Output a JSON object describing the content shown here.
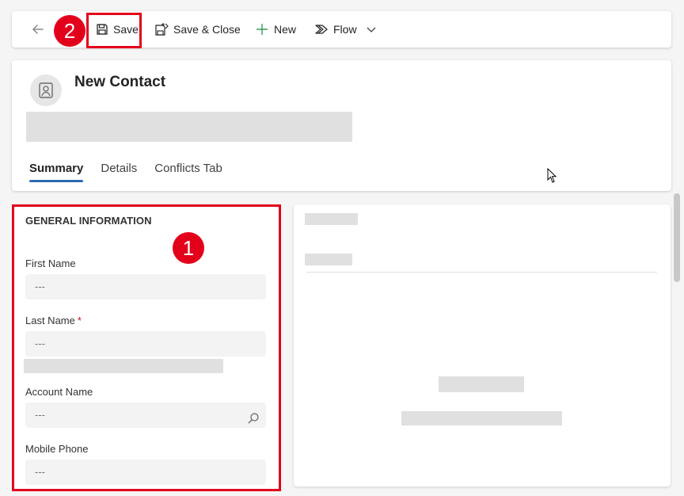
{
  "toolbar": {
    "back_label": "Back",
    "save_label": "Save",
    "save_close_label": "Save & Close",
    "new_label": "New",
    "flow_label": "Flow"
  },
  "annotations": {
    "badge_1": "1",
    "badge_2": "2"
  },
  "header": {
    "title": "New Contact",
    "tabs": [
      {
        "label": "Summary",
        "active": true
      },
      {
        "label": "Details",
        "active": false
      },
      {
        "label": "Conflicts Tab",
        "active": false
      }
    ]
  },
  "general_information": {
    "section_title": "GENERAL INFORMATION",
    "fields": [
      {
        "label": "First Name",
        "value": "---",
        "required": false
      },
      {
        "label": "Last Name",
        "value": "---",
        "required": true,
        "required_marker": "*"
      },
      {
        "label": "Account Name",
        "value": "---",
        "required": false,
        "icon": "search-icon"
      },
      {
        "label": "Mobile Phone",
        "value": "---",
        "required": false
      }
    ]
  },
  "colors": {
    "accent": "#2b6cb0",
    "annotation_red": "#e3001b",
    "skeleton": "#e0e0e0",
    "input_bg": "#f3f3f3",
    "page_bg": "#f5f5f5"
  }
}
